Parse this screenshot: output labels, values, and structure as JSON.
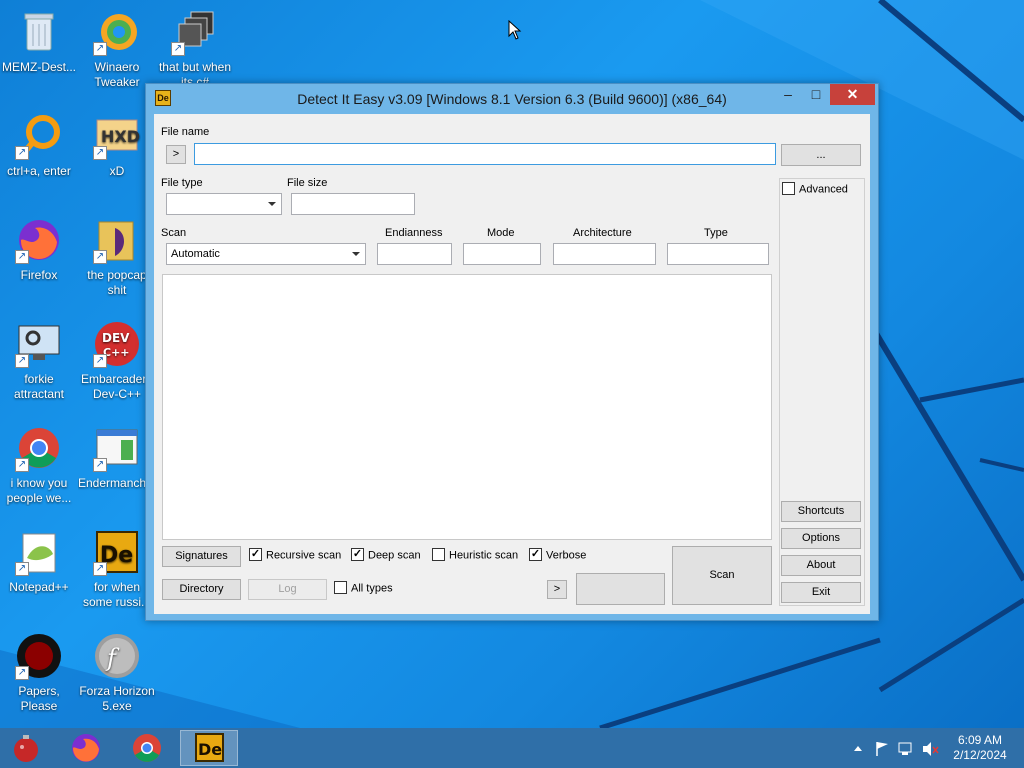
{
  "desktop": {
    "icons": [
      {
        "label": "MEMZ-Dest...",
        "icon": "recycle-bin-icon"
      },
      {
        "label": "Winaero Tweaker",
        "icon": "winaero-icon"
      },
      {
        "label": "that but when its c#",
        "icon": "stacked-windows-icon"
      },
      {
        "label": "ctrl+a, enter",
        "icon": "search-ring-icon"
      },
      {
        "label": "xD",
        "icon": "hxd-icon"
      },
      {
        "label": "Firefox",
        "icon": "firefox-icon"
      },
      {
        "label": "the popcap shit",
        "icon": "folder-icon"
      },
      {
        "label": "forkie attractant",
        "icon": "computer-settings-icon"
      },
      {
        "label": "Embarcadero Dev-C++",
        "icon": "devcpp-icon"
      },
      {
        "label": "i know you people we...",
        "icon": "chrome-icon"
      },
      {
        "label": "Endermanch...",
        "icon": "window-app-icon"
      },
      {
        "label": "Notepad++",
        "icon": "notepadpp-icon"
      },
      {
        "label": "for when some russi...",
        "icon": "die-icon"
      },
      {
        "label": "Papers, Please",
        "icon": "papers-please-icon"
      },
      {
        "label": "Forza Horizon 5.exe",
        "icon": "flash-icon"
      }
    ]
  },
  "window": {
    "title": "Detect It Easy v3.09 [Windows 8.1 Version 6.3 (Build 9600)] (x86_64)",
    "app_icon_text": "De",
    "controls": {
      "minimize": "–",
      "maximize": "□",
      "close": "✕"
    }
  },
  "form": {
    "file_name_label": "File name",
    "file_name_value": "",
    "go_button": ">",
    "browse_button": "...",
    "file_type_label": "File type",
    "file_type_value": "",
    "file_size_label": "File size",
    "file_size_value": "",
    "scan_label": "Scan",
    "scan_value": "Automatic",
    "endianness_label": "Endianness",
    "mode_label": "Mode",
    "architecture_label": "Architecture",
    "type_label": "Type",
    "advanced_label": "Advanced",
    "advanced_checked": false
  },
  "bottom": {
    "signatures_button": "Signatures",
    "directory_button": "Directory",
    "log_button": "Log",
    "recursive_scan": {
      "label": "Recursive scan",
      "checked": true
    },
    "deep_scan": {
      "label": "Deep scan",
      "checked": true
    },
    "heuristic_scan": {
      "label": "Heuristic scan",
      "checked": false
    },
    "verbose": {
      "label": "Verbose",
      "checked": true
    },
    "all_types": {
      "label": "All types",
      "checked": false
    },
    "arrow_button": ">",
    "scan_button": "Scan"
  },
  "side_buttons": {
    "shortcuts": "Shortcuts",
    "options": "Options",
    "about": "About",
    "exit": "Exit"
  },
  "taskbar": {
    "apps": [
      "christmas-ornament-icon",
      "firefox-icon",
      "chrome-icon",
      "die-icon"
    ],
    "active_app": "die-icon",
    "clock_time": "6:09 AM",
    "clock_date": "2/12/2024"
  },
  "colors": {
    "title_bar": "#6fb6e8",
    "close_button": "#c7413b",
    "taskbar": "#2f6fa8",
    "desktop": "#1a8fe0"
  }
}
